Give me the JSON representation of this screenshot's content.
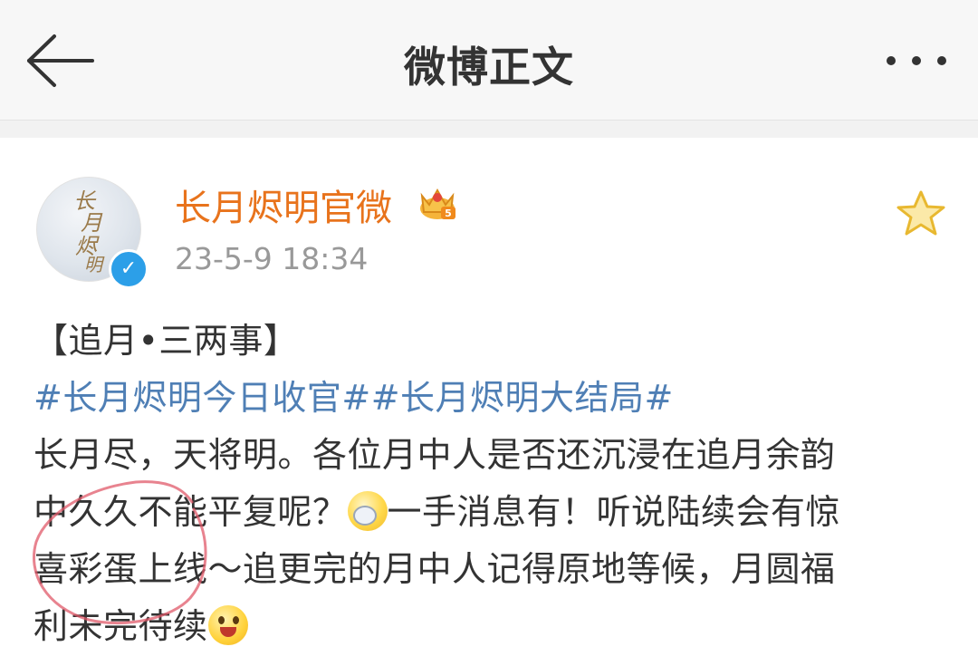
{
  "header": {
    "title": "微博正文",
    "back_icon": "back-arrow-icon",
    "more_icon": "more-dots-icon"
  },
  "post": {
    "author": {
      "name": "长月烬明官微",
      "avatar_text": [
        "长",
        "月",
        "烬",
        "明"
      ],
      "verified": true,
      "badge_icon": "crown-icon"
    },
    "timestamp": "23-5-9 18:34",
    "favorite_icon": "star-icon",
    "lines": {
      "heading": "【追月•三两事】",
      "hashtag1": "#长月烬明今日收官#",
      "hashtag2": "#长月烬明大结局#",
      "l1": "长月尽，天将明。各位月中人是否还沉浸在追月余韵",
      "l2a": "中久久不能平复呢？",
      "l2b": "一手消息有！听说陆续会有惊",
      "l3": "喜彩蛋上线～追更完的月中人记得原地等候，月圆福",
      "l4": "利未完待续"
    }
  },
  "colors": {
    "username": "#e8731c",
    "hashtag": "#4f7fb5",
    "text": "#333333",
    "timestamp": "#999999",
    "verified": "#2c9fe8",
    "annotation": "#e05a6a"
  }
}
